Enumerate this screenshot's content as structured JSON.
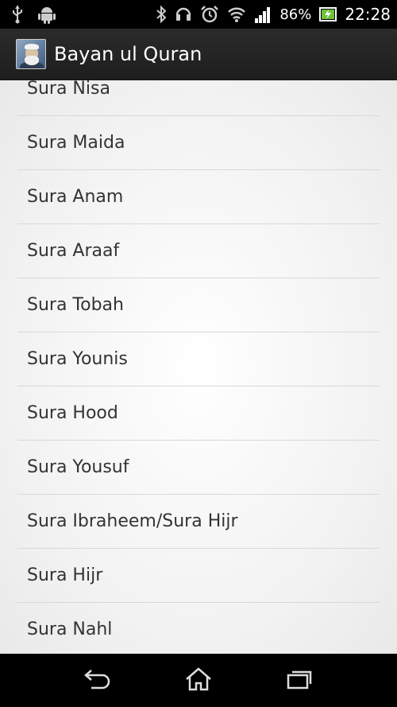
{
  "status_bar": {
    "battery_percent": "86%",
    "clock": "22:28",
    "icons": [
      "usb-icon",
      "android-debug-icon",
      "bluetooth-icon",
      "headset-icon",
      "alarm-icon",
      "wifi-icon",
      "signal-icon",
      "battery-charging-icon"
    ]
  },
  "action_bar": {
    "title": "Bayan ul Quran",
    "icon": "app-avatar"
  },
  "list": {
    "items": [
      "Sura Nisa",
      "Sura Maida",
      "Sura Anam",
      "Sura Araaf",
      "Sura Tobah",
      "Sura Younis",
      "Sura Hood",
      "Sura Yousuf",
      "Sura Ibraheem/Sura Hijr",
      "Sura Hijr",
      "Sura Nahl"
    ]
  },
  "nav_bar": {
    "buttons": [
      "back-icon",
      "home-icon",
      "recent-apps-icon"
    ]
  }
}
